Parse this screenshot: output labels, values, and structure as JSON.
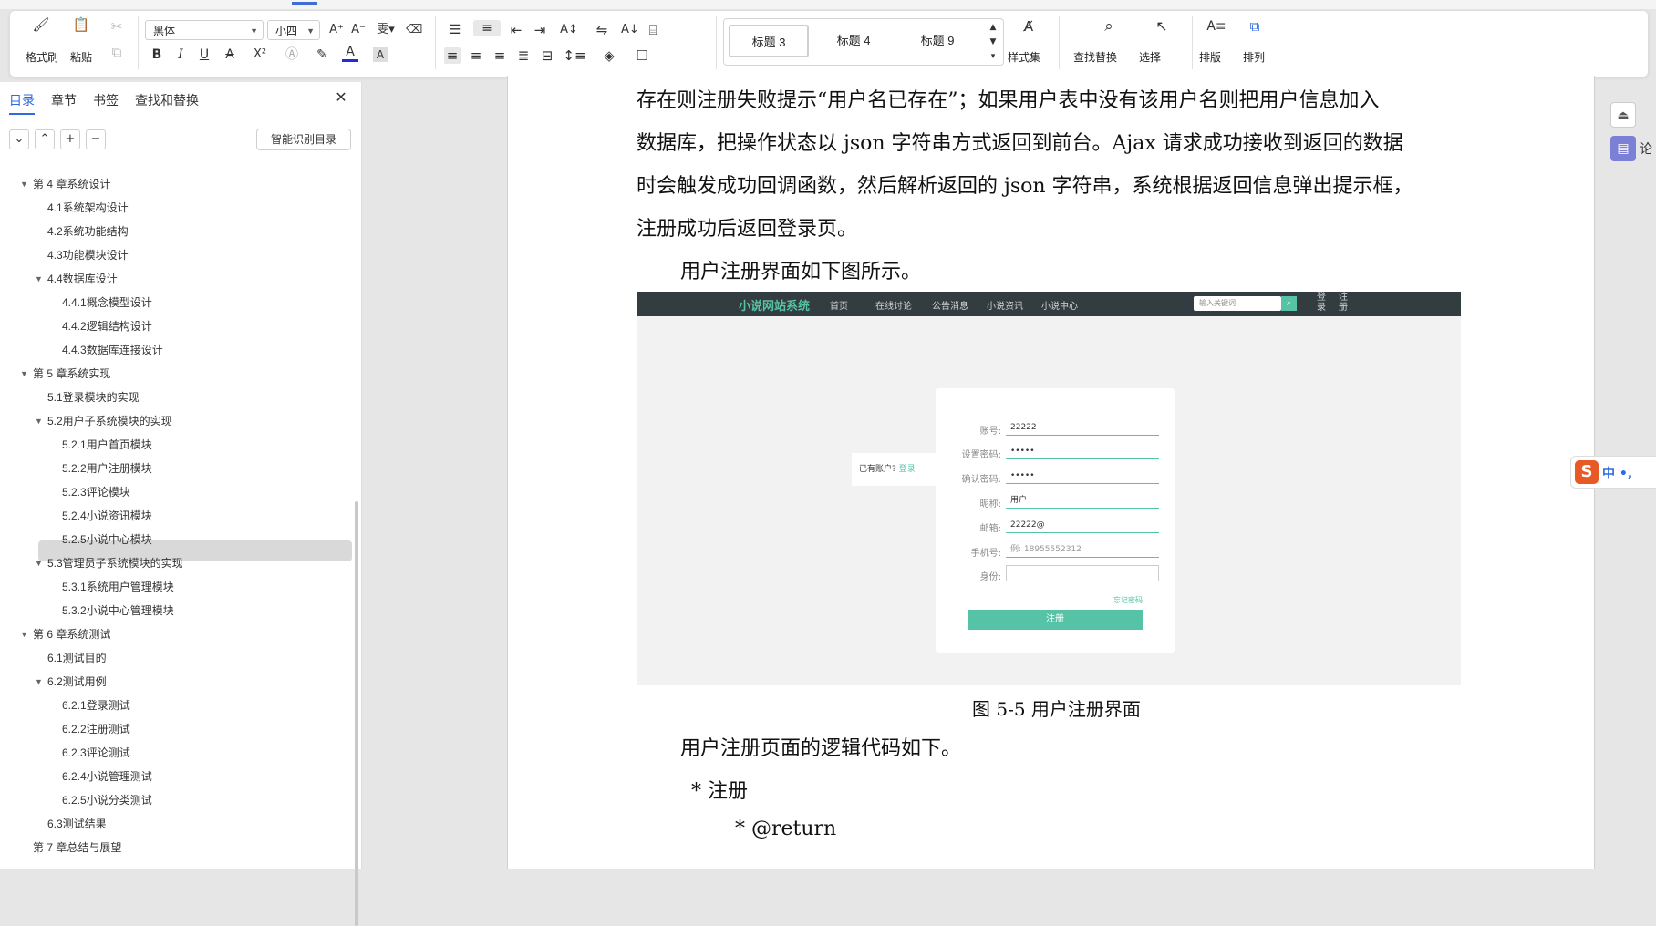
{
  "ribbon": {
    "format_painter": "格式刷",
    "paste": "粘贴",
    "font_name": "黑体",
    "font_size": "小四",
    "styles": [
      "标题 3",
      "标题 4",
      "标题 9"
    ],
    "style_set": "样式集",
    "find_replace": "查找替换",
    "select": "选择",
    "layout": "排版",
    "arrange": "排列",
    "bold": "B",
    "italic": "I",
    "underline": "U",
    "strike": "A",
    "superscript": "X²",
    "fontcolor": "A",
    "charbox": "A"
  },
  "sidebar": {
    "tabs": [
      "目录",
      "章节",
      "书签",
      "查找和替换"
    ],
    "smart_toc": "智能识别目录",
    "items": [
      {
        "label": "第 4 章系统设计",
        "level": 0,
        "expanded": true
      },
      {
        "label": "4.1系统架构设计",
        "level": 1
      },
      {
        "label": "4.2系统功能结构",
        "level": 1
      },
      {
        "label": "4.3功能模块设计",
        "level": 1
      },
      {
        "label": "4.4数据库设计",
        "level": 1,
        "expanded": true
      },
      {
        "label": "4.4.1概念模型设计",
        "level": 2
      },
      {
        "label": "4.4.2逻辑结构设计",
        "level": 2
      },
      {
        "label": "4.4.3数据库连接设计",
        "level": 2
      },
      {
        "label": "第 5 章系统实现",
        "level": 0,
        "expanded": true
      },
      {
        "label": "5.1登录模块的实现",
        "level": 1
      },
      {
        "label": "5.2用户子系统模块的实现",
        "level": 1,
        "expanded": true
      },
      {
        "label": "5.2.1用户首页模块",
        "level": 2
      },
      {
        "label": "5.2.2用户注册模块",
        "level": 2,
        "selected": true
      },
      {
        "label": "5.2.3评论模块",
        "level": 2
      },
      {
        "label": "5.2.4小说资讯模块",
        "level": 2
      },
      {
        "label": "5.2.5小说中心模块",
        "level": 2
      },
      {
        "label": "5.3管理员子系统模块的实现",
        "level": 1,
        "expanded": true
      },
      {
        "label": "5.3.1系统用户管理模块",
        "level": 2
      },
      {
        "label": "5.3.2小说中心管理模块",
        "level": 2
      },
      {
        "label": "第 6 章系统测试",
        "level": 0,
        "expanded": true
      },
      {
        "label": "6.1测试目的",
        "level": 1
      },
      {
        "label": "6.2测试用例",
        "level": 1,
        "expanded": true
      },
      {
        "label": "6.2.1登录测试",
        "level": 2
      },
      {
        "label": "6.2.2注册测试",
        "level": 2
      },
      {
        "label": "6.2.3评论测试",
        "level": 2
      },
      {
        "label": "6.2.4小说管理测试",
        "level": 2
      },
      {
        "label": "6.2.5小说分类测试",
        "level": 2
      },
      {
        "label": "6.3测试结果",
        "level": 1
      },
      {
        "label": "第 7 章总结与展望",
        "level": 0
      }
    ]
  },
  "doc": {
    "para_lines": [
      "存在则注册失败提示“用户名已存在”；如果用户表中没有该用户名则把用户信息加入",
      "数据库，把操作状态以 json 字符串方式返回到前台。Ajax 请求成功接收到返回的数据",
      "时会触发成功回调函数，然后解析返回的 json 字符串，系统根据返回信息弹出提示框，",
      "注册成功后返回登录页。"
    ],
    "intro": "用户注册界面如下图所示。",
    "caption": "图 5-5 用户注册界面",
    "after": "用户注册页面的逻辑代码如下。",
    "code1": "*  注册",
    "code2": "* @return"
  },
  "figure": {
    "brand": "小说网站系统",
    "nav": [
      "首页",
      "在线讨论",
      "公告消息",
      "小说资讯",
      "小说中心"
    ],
    "search_placeholder": "输入关键词",
    "login": "登录",
    "register": "注册",
    "has_account": "已有账户?",
    "login_link": "登录",
    "labels": [
      "账号:",
      "设置密码:",
      "确认密码:",
      "昵称:",
      "邮箱:",
      "手机号:",
      "身份:"
    ],
    "values": [
      "22222",
      "•••••",
      "•••••",
      "用户",
      "22222@",
      "例: 18955552312",
      ""
    ],
    "forgot": "忘记密码",
    "submit": "注册"
  },
  "ime": {
    "label": "中 •, "
  },
  "right_panel": {
    "label": "论"
  }
}
